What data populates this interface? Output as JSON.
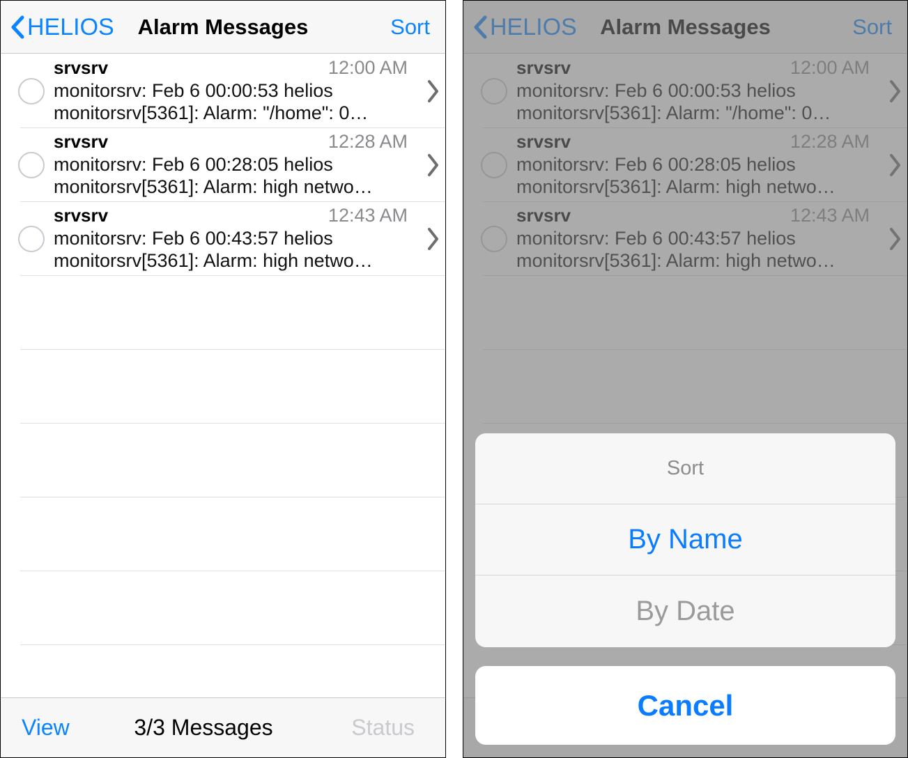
{
  "colors": {
    "accent_blue": "#0a84ff",
    "sheet_blue": "#0a7cff",
    "disabled_gray": "#9a9a9a",
    "time_gray": "#8a8a8e",
    "bar_bg": "#f7f7f7",
    "dim_overlay": "#777777"
  },
  "navbar": {
    "back_label": "HELIOS",
    "back_icon": "chevron-left-icon",
    "title": "Alarm Messages",
    "action_label": "Sort"
  },
  "messages": [
    {
      "sender": "srvsrv",
      "time": "12:00 AM",
      "line1": "monitorsrv: Feb  6 00:00:53 helios",
      "line2": "monitorsrv[5361]: Alarm: \"/home\": 0…",
      "checkbox": "unchecked",
      "disclosure_icon": "chevron-right-icon"
    },
    {
      "sender": "srvsrv",
      "time": "12:28 AM",
      "line1": "monitorsrv: Feb  6 00:28:05 helios",
      "line2": "monitorsrv[5361]: Alarm: high netwo…",
      "checkbox": "unchecked",
      "disclosure_icon": "chevron-right-icon"
    },
    {
      "sender": "srvsrv",
      "time": "12:43 AM",
      "line1": "monitorsrv: Feb  6 00:43:57 helios",
      "line2": "monitorsrv[5361]: Alarm: high netwo…",
      "checkbox": "unchecked",
      "disclosure_icon": "chevron-right-icon"
    }
  ],
  "toolbar": {
    "view_label": "View",
    "count_label": "3/3 Messages",
    "status_label": "Status"
  },
  "action_sheet": {
    "title": "Sort",
    "options": [
      {
        "label": "By Name",
        "state": "enabled"
      },
      {
        "label": "By Date",
        "state": "disabled"
      }
    ],
    "cancel_label": "Cancel"
  }
}
